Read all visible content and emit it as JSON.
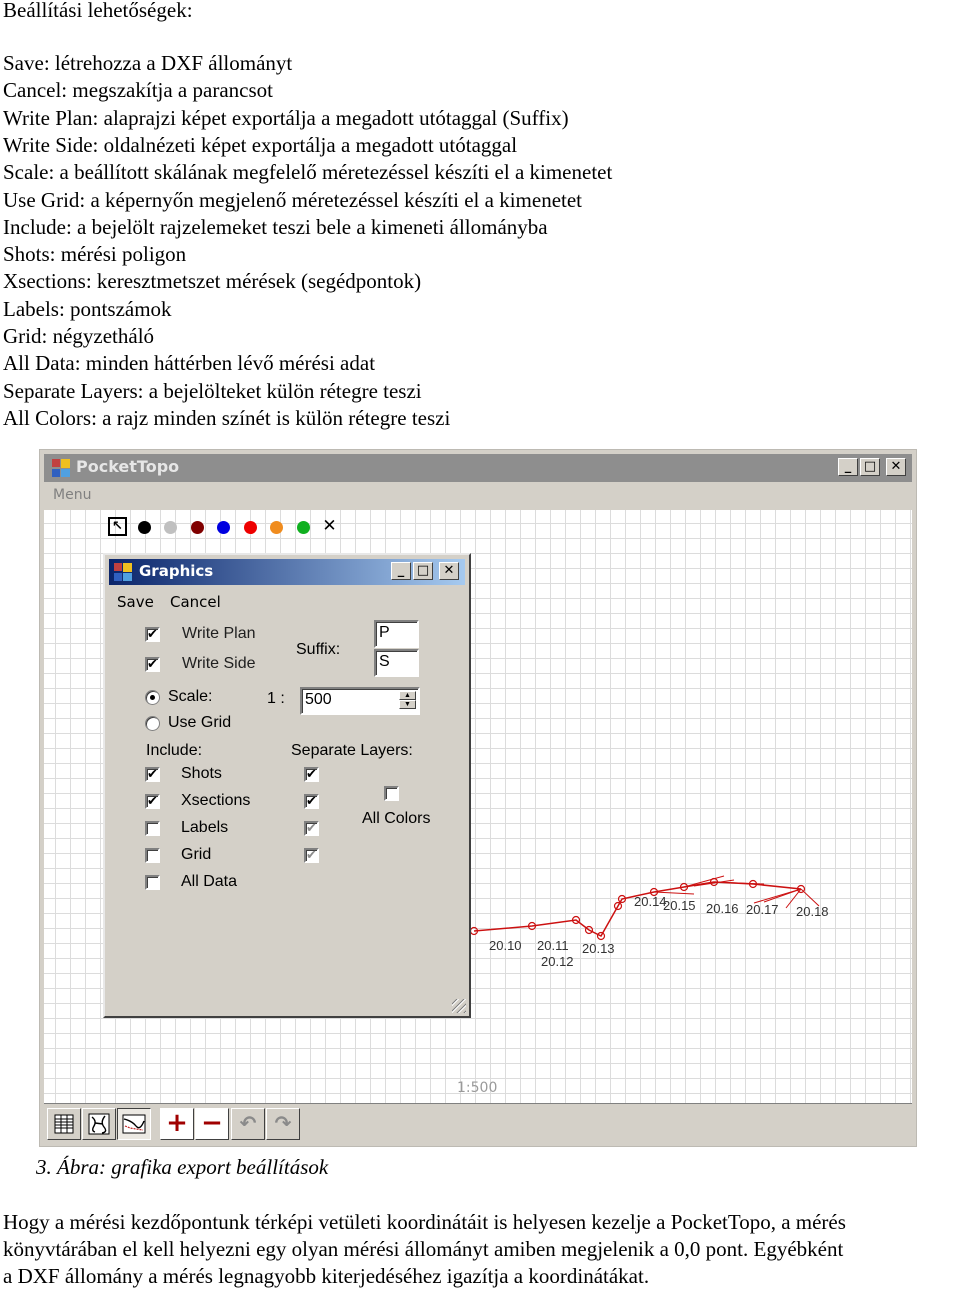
{
  "document": {
    "heading": "Beállítási lehetőségek:",
    "options": [
      "Save: létrehozza a DXF állományt",
      "Cancel: megszakítja a parancsot",
      "Write Plan: alaprajzi képet exportálja a megadott utótaggal (Suffix)",
      "Write Side: oldalnézeti képet exportálja a megadott utótaggal",
      "Scale: a beállított skálának megfelelő méretezéssel készíti el a kimenetet",
      "Use Grid: a képernyőn megjelenő méretezéssel készíti el a kimenetet",
      "Include: a bejelölt rajzelemeket teszi bele a kimeneti állományba",
      "Shots: mérési poligon",
      "Xsections: keresztmetszet mérések (segédpontok)",
      "Labels: pontszámok",
      "Grid: négyzetháló",
      "All Data: minden háttérben lévő mérési adat",
      "Separate Layers: a bejelölteket külön rétegre teszi",
      "All Colors: a rajz minden színét is külön rétegre teszi"
    ],
    "caption": "3. Ábra: grafika export beállítások",
    "paragraph": [
      "Hogy a mérési kezdőpontunk térképi vetületi koordinátáit is helyesen kezelje a PocketTopo, a mérés",
      "könyvtárában el kell helyezni egy olyan mérési állományt amiben megjelenik a 0,0 pont. Egyébként",
      "a DXF állomány a mérés legnagyobb kiterjedéséhez igazítja a koordinátákat."
    ]
  },
  "app": {
    "title": "PocketTopo",
    "menu": "Menu",
    "title_buttons": {
      "minimize": "_",
      "maximize": "□",
      "close": "✕"
    },
    "palette": [
      {
        "name": "select-tool",
        "glyph": "↖"
      },
      {
        "name": "black",
        "color": "#000000"
      },
      {
        "name": "gray",
        "color": "#c0c0c0"
      },
      {
        "name": "dark-red",
        "color": "#800000"
      },
      {
        "name": "blue",
        "color": "#0000e0"
      },
      {
        "name": "red",
        "color": "#ee0000"
      },
      {
        "name": "orange",
        "color": "#f08c1e"
      },
      {
        "name": "green",
        "color": "#10b020"
      },
      {
        "name": "delete-tool",
        "glyph": "✕"
      }
    ],
    "scale_label": "1:500",
    "station_labels": [
      "20.10",
      "20.11",
      "20.12",
      "20.13",
      "20.14",
      "20.15",
      "20.16",
      "20.17",
      "20.18"
    ],
    "toolbar": {
      "zoom_in": "+",
      "zoom_out": "−",
      "undo": "↶",
      "redo": "↷"
    },
    "survey_color": "#cc1111"
  },
  "dialog": {
    "title": "Graphics",
    "menu": {
      "save": "Save",
      "cancel": "Cancel"
    },
    "write_plan": {
      "label": "Write Plan",
      "checked": true
    },
    "write_side": {
      "label": "Write Side",
      "checked": true
    },
    "suffix_label": "Suffix:",
    "suffix_plan": "P",
    "suffix_side": "S",
    "scale_radio": {
      "label": "Scale:",
      "selected": true
    },
    "use_grid_radio": {
      "label": "Use Grid",
      "selected": false
    },
    "scale_prefix": "1 :",
    "scale_value": "500",
    "include_label": "Include:",
    "separate_layers_label": "Separate Layers:",
    "include": [
      {
        "label": "Shots",
        "checked": true,
        "layer_checked": true,
        "layer_enabled": true
      },
      {
        "label": "Xsections",
        "checked": true,
        "layer_checked": true,
        "layer_enabled": true
      },
      {
        "label": "Labels",
        "checked": false,
        "layer_checked": true,
        "layer_enabled": false
      },
      {
        "label": "Grid",
        "checked": false,
        "layer_checked": true,
        "layer_enabled": false
      },
      {
        "label": "All Data",
        "checked": false
      }
    ],
    "all_colors": {
      "label": "All Colors",
      "checked": false
    },
    "check_glyph": "✔"
  }
}
